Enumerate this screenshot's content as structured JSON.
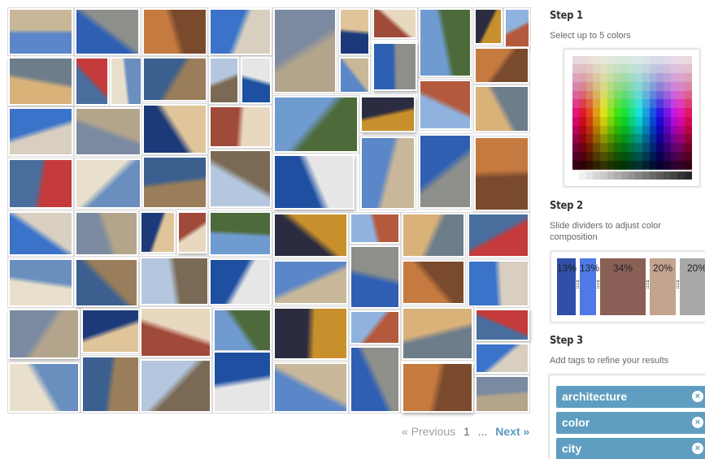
{
  "pagination": {
    "previous_label": "« Previous",
    "current_page": "1",
    "ellipsis": "...",
    "next_label": "Next »"
  },
  "step1": {
    "title": "Step 1",
    "subtitle": "Select up to 5 colors"
  },
  "step2": {
    "title": "Step 2",
    "subtitle": "Slide dividers to adjust color composition",
    "segments": [
      {
        "label": "13%",
        "color": "#2f4fa8"
      },
      {
        "label": "13%",
        "color": "#4f79e6"
      },
      {
        "label": "34%",
        "color": "#8a5f55"
      },
      {
        "label": "20%",
        "color": "#c3a48e"
      },
      {
        "label": "20%",
        "color": "#a9a8a8"
      }
    ]
  },
  "step3": {
    "title": "Step 3",
    "subtitle": "Add tags to refine your results",
    "tags": [
      {
        "label": "architecture"
      },
      {
        "label": "color"
      },
      {
        "label": "city"
      }
    ],
    "remove_icon": "×"
  }
}
